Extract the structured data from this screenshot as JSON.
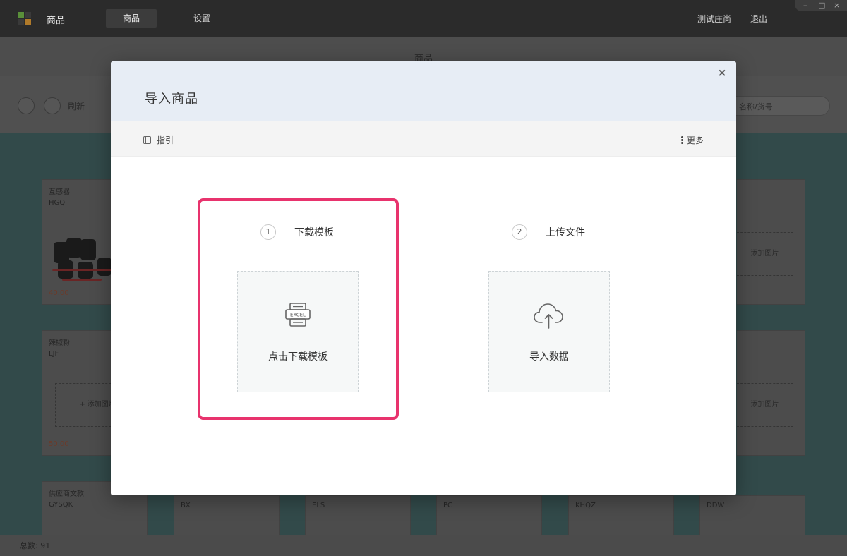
{
  "app": {
    "name": "商品",
    "nav_tabs": [
      {
        "label": "商品",
        "active": true
      },
      {
        "label": "设置",
        "active": false
      }
    ],
    "store_name": "测试庄尚",
    "logout_label": "退出"
  },
  "window_controls": {
    "minimize": "–",
    "maximize": "□",
    "close": "×"
  },
  "page": {
    "title": "商品",
    "refresh_label": "刷新",
    "search_placeholder": "名称/货号"
  },
  "background_cards": [
    {
      "name": "互感器",
      "code": "HGQ",
      "price": "40.00"
    },
    {
      "name": "辣椒粉",
      "code": "LJF",
      "price": "50.00",
      "add_image_label": "+ 添加图片"
    },
    {
      "name": "供应商文款",
      "code": "GYSQK"
    },
    {
      "code": "BX"
    },
    {
      "code": "ELS"
    },
    {
      "code": "PC"
    },
    {
      "code": "KHQZ"
    },
    {
      "code": "DDW"
    }
  ],
  "right_cards": {
    "add_image_label": "添加图片"
  },
  "status": {
    "total_label": "总数: 91"
  },
  "modal": {
    "title": "导入商品",
    "close_icon": "×",
    "guide_label": "指引",
    "more_label": "更多",
    "steps": [
      {
        "number": "1",
        "label": "下载模板",
        "action_label": "点击下载模板",
        "icon": "excel-file-icon",
        "icon_text": "EXCEL",
        "highlighted": true
      },
      {
        "number": "2",
        "label": "上传文件",
        "action_label": "导入数据",
        "icon": "cloud-upload-icon"
      }
    ]
  },
  "colors": {
    "highlight": "#e8336d",
    "modal_header": "#e7edf5",
    "modal_toolbar": "#f4f4f4",
    "action_box_bg": "#f6f8f8"
  }
}
